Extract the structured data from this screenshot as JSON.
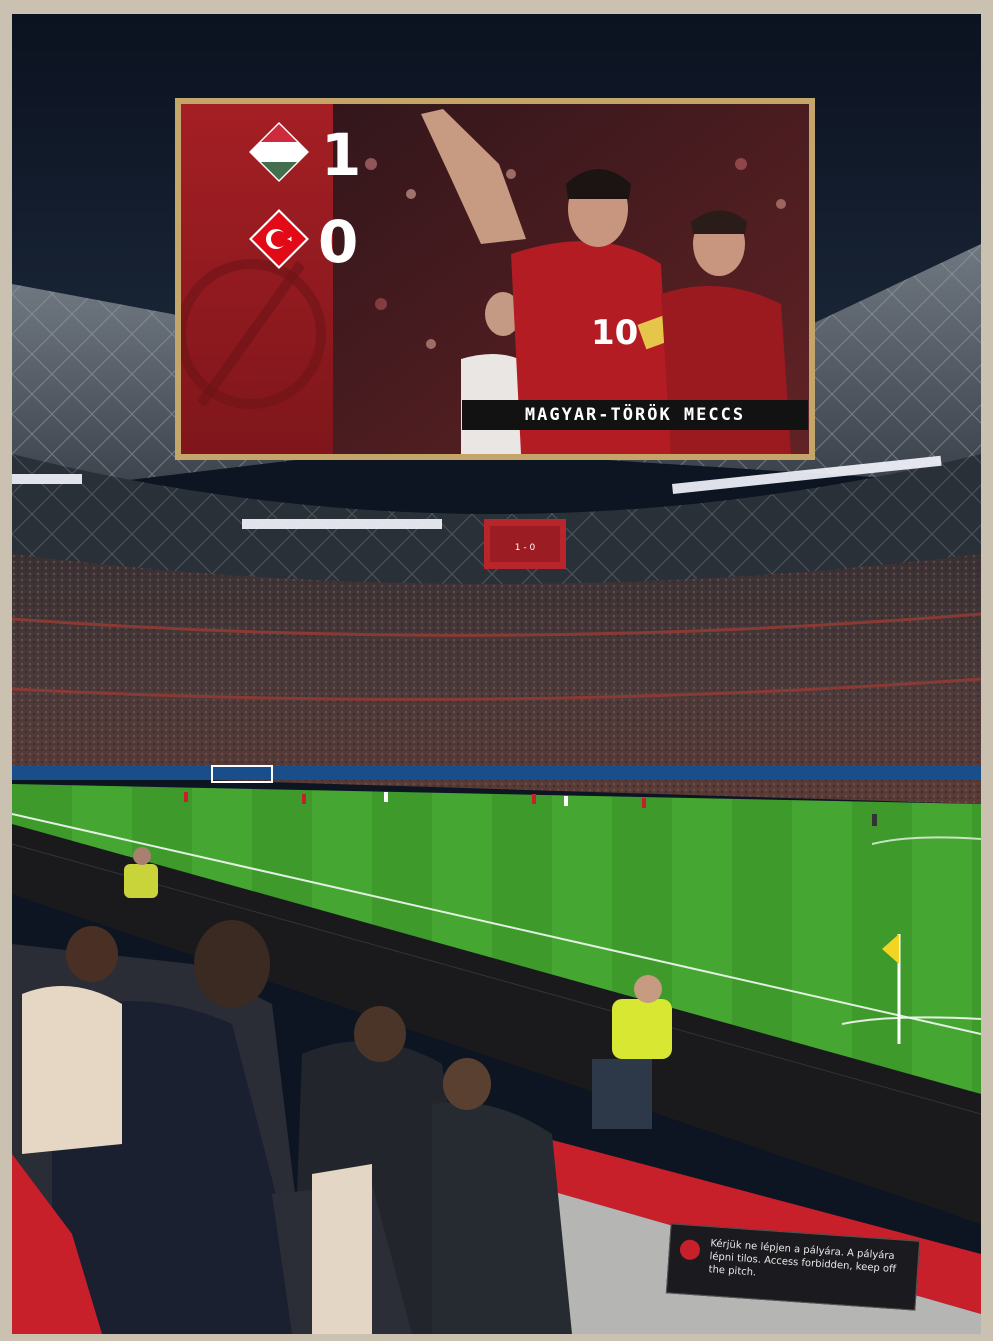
{
  "scoreboard": {
    "home_team_flag": "hungary-flag-icon",
    "away_team_flag": "turkey-flag-icon",
    "home_score": "1",
    "away_score": "0",
    "caption": "MAGYAR-TÖRÖK MECCS"
  },
  "stadium_screen": {
    "score_text": "1 - 0"
  },
  "pitch_sign": {
    "text": "Kérjük ne lépjen a pályára. A pályára lépni tilos. Access forbidden, keep off the pitch."
  },
  "colors": {
    "card_red": "#8b1a1e",
    "card_border": "#c4a56a",
    "caption_bg": "#121212",
    "pitch_green": "#3f9a2a",
    "seat_red": "#c8202a",
    "frame_beige": "#cbc1b0"
  }
}
